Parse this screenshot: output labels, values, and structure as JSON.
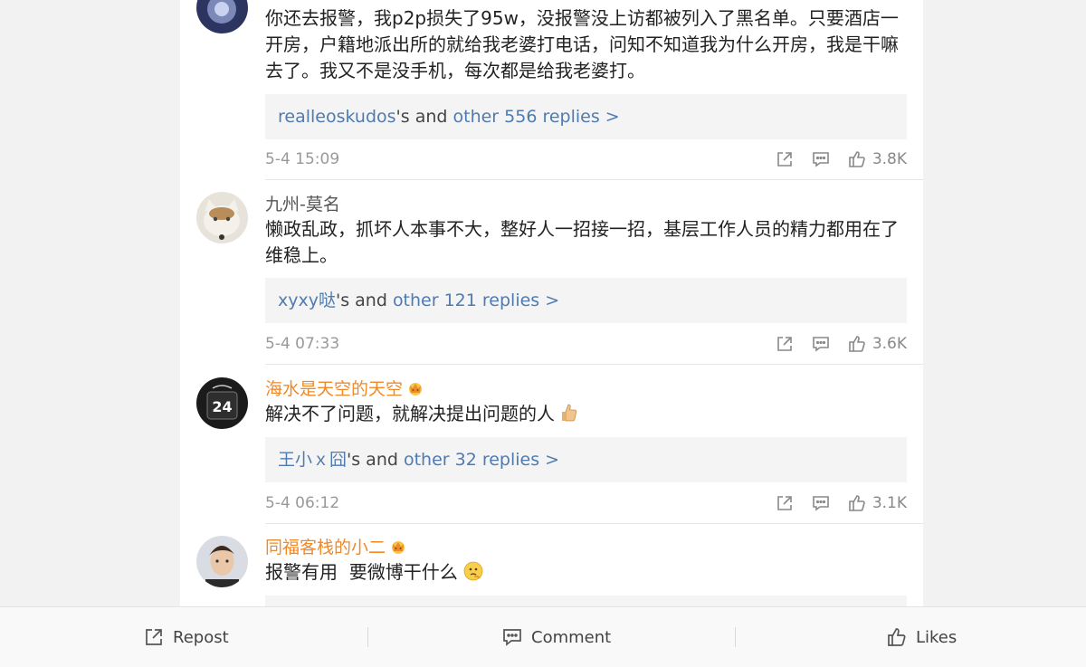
{
  "comments": [
    {
      "username": "",
      "text": "你还去报警，我p2p损失了95w，没报警没上访都被列入了黑名单。只要酒店一开房，户籍地派出所的就给我老婆打电话，问知不知道我为什么开房，我是干嘛去了。我又不是没手机，每次都是给我老婆打。",
      "reply_user": "realleoskudos",
      "reply_mid": "'s and ",
      "reply_more": "other 556 replies >",
      "time": "5-4 15:09",
      "likes": "3.8K"
    },
    {
      "username": "九州-莫名",
      "text": "懒政乱政，抓坏人本事不大，整好人一招接一招，基层工作人员的精力都用在了维稳上。",
      "reply_user": "xyxy哒",
      "reply_mid": "'s and ",
      "reply_more": "other 121 replies >",
      "time": "5-4 07:33",
      "likes": "3.6K"
    },
    {
      "username": "海水是天空的天空",
      "text": "解决不了问题，就解决提出问题的人",
      "reply_user": "王小ｘ囧",
      "reply_mid": "'s and ",
      "reply_more": "other 32 replies >",
      "time": "5-4 06:12",
      "likes": "3.1K"
    },
    {
      "username": "同福客栈的小二",
      "text": "报警有用  要微博干什么"
    }
  ],
  "bottom_bar": {
    "repost_label": "Repost",
    "comment_label": "Comment",
    "likes_label": "Likes"
  },
  "colors": {
    "link_blue": "#4f7bb0",
    "vip_orange": "#ef8a2b",
    "muted": "#999999"
  }
}
